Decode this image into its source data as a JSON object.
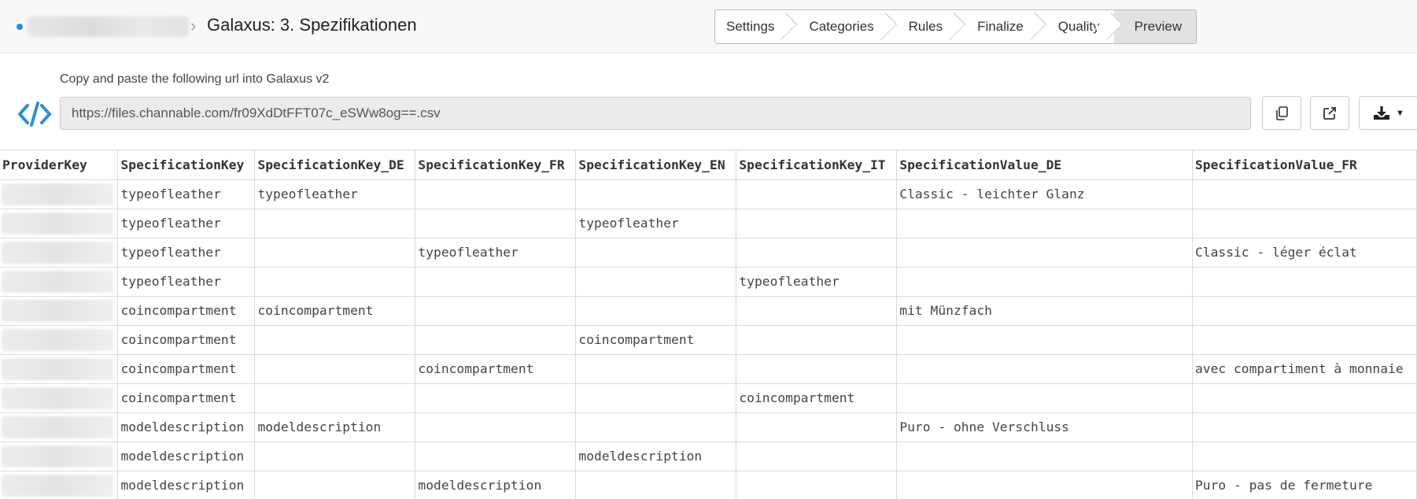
{
  "header": {
    "title": "Galaxus: 3. Spezifikationen",
    "steps": [
      "Settings",
      "Categories",
      "Rules",
      "Finalize",
      "Quality",
      "Preview"
    ],
    "active_step": "Preview"
  },
  "export": {
    "label": "Copy and paste the following url into Galaxus v2",
    "url": "https://files.channable.com/fr09XdDtFFT07c_eSWw8og==.csv",
    "buttons": [
      "copy-icon",
      "external-link-icon",
      "download-icon"
    ]
  },
  "colors": {
    "accent": "#2a8fd6",
    "active_step_bg": "#e2e2e2",
    "url_box_bg": "#ebebeb"
  },
  "table": {
    "columns": [
      "ProviderKey",
      "SpecificationKey",
      "SpecificationKey_DE",
      "SpecificationKey_FR",
      "SpecificationKey_EN",
      "SpecificationKey_IT",
      "SpecificationValue_DE",
      "SpecificationValue_FR"
    ],
    "rows": [
      [
        "",
        "typeofleather",
        "typeofleather",
        "",
        "",
        "",
        "Classic - leichter Glanz",
        ""
      ],
      [
        "",
        "typeofleather",
        "",
        "",
        "typeofleather",
        "",
        "",
        ""
      ],
      [
        "",
        "typeofleather",
        "",
        "typeofleather",
        "",
        "",
        "",
        "Classic - léger éclat"
      ],
      [
        "",
        "typeofleather",
        "",
        "",
        "",
        "typeofleather",
        "",
        ""
      ],
      [
        "",
        "coincompartment",
        "coincompartment",
        "",
        "",
        "",
        "mit Münzfach",
        ""
      ],
      [
        "",
        "coincompartment",
        "",
        "",
        "coincompartment",
        "",
        "",
        ""
      ],
      [
        "",
        "coincompartment",
        "",
        "coincompartment",
        "",
        "",
        "",
        "avec compartiment à monnaie"
      ],
      [
        "",
        "coincompartment",
        "",
        "",
        "",
        "coincompartment",
        "",
        ""
      ],
      [
        "",
        "modeldescription",
        "modeldescription",
        "",
        "",
        "",
        "Puro - ohne Verschluss",
        ""
      ],
      [
        "",
        "modeldescription",
        "",
        "",
        "modeldescription",
        "",
        "",
        ""
      ],
      [
        "",
        "modeldescription",
        "",
        "modeldescription",
        "",
        "",
        "",
        "Puro - pas de fermeture"
      ]
    ]
  }
}
